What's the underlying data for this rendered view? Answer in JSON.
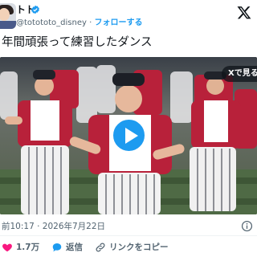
{
  "post": {
    "author_name": "トト",
    "handle": "@totototo_disney",
    "separator": "·",
    "follow_label": "フォローする",
    "text": "年間頑張って練習したダンス",
    "watch_on_x": "Xで見る",
    "timestamp": "前10:17 · 2026年7月22日"
  },
  "actions": {
    "likes_count": "1.7万",
    "reply_label": "返信",
    "copy_link_label": "リンクをコピー"
  },
  "colors": {
    "accent": "#1d9bf0",
    "like": "#f91880",
    "text": "#0f1419",
    "secondary": "#536471",
    "uniform_red": "#b8213a"
  },
  "icons": {
    "verified": "verified-badge-icon",
    "x_logo": "x-logo-icon",
    "play": "play-icon",
    "info": "info-icon",
    "like": "heart-icon",
    "reply": "reply-bubble-icon",
    "link": "link-icon"
  }
}
